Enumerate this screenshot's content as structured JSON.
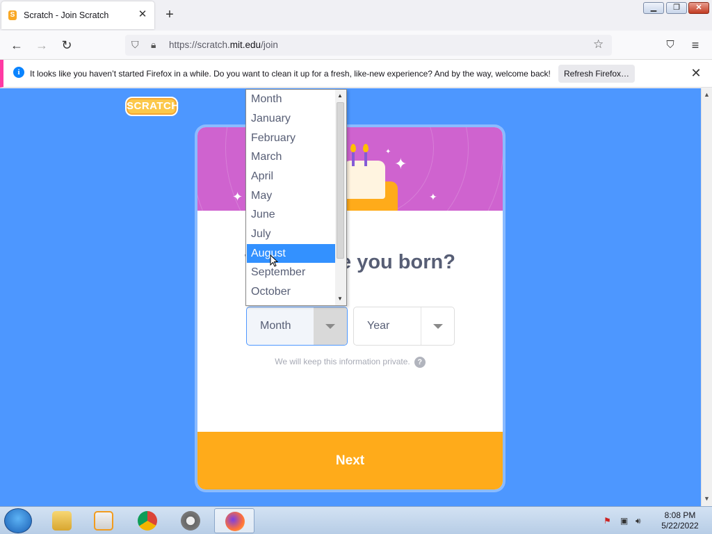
{
  "browser": {
    "tab_title": "Scratch - Join Scratch",
    "tab_close": "✕",
    "new_tab": "+",
    "url_prefix": "https://scratch.",
    "url_domain": "mit.edu",
    "url_path": "/join"
  },
  "notification": {
    "message": "It looks like you haven’t started Firefox in a while. Do you want to clean it up for a fresh, like-new experience? And by the way, welcome back!",
    "button": "Refresh Firefox…"
  },
  "page": {
    "logo_text": "SCRATCH",
    "question": "When were you born?",
    "month_select": {
      "selected": "Month"
    },
    "year_select": {
      "selected": "Year"
    },
    "privacy_note": "We will keep this information private.",
    "next_label": "Next",
    "colors": {
      "background": "#4d97ff",
      "banner": "#cf63cf",
      "next": "#ffab1a",
      "text": "#575e75"
    }
  },
  "dropdown": {
    "options": [
      "Month",
      "January",
      "February",
      "March",
      "April",
      "May",
      "June",
      "July",
      "August",
      "September",
      "October"
    ],
    "highlighted": "August"
  },
  "taskbar": {
    "time": "8:08 PM",
    "date": "5/22/2022",
    "apps": [
      "file-explorer",
      "media-player",
      "chrome",
      "settings",
      "firefox"
    ]
  }
}
